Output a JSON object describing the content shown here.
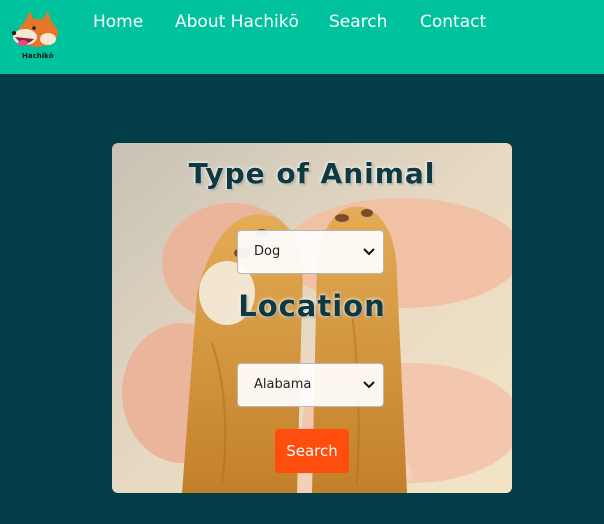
{
  "brand": {
    "logo_text": "Hachikō"
  },
  "nav": {
    "items": [
      {
        "label": "Home"
      },
      {
        "label": "About Hachikō"
      },
      {
        "label": "Search"
      },
      {
        "label": "Contact"
      }
    ]
  },
  "search_form": {
    "animal_heading": "Type of Animal",
    "animal_select": {
      "selected": "Dog"
    },
    "location_heading": "Location",
    "location_select": {
      "selected": "Alabama"
    },
    "search_button": "Search"
  },
  "colors": {
    "topbar": "#00c29d",
    "page_bg": "#033d48",
    "button": "#ff4d0d",
    "heading": "#0f3940"
  },
  "icons": {
    "logo": "shiba-dog-head-icon",
    "select_arrow": "chevron-down-icon"
  }
}
